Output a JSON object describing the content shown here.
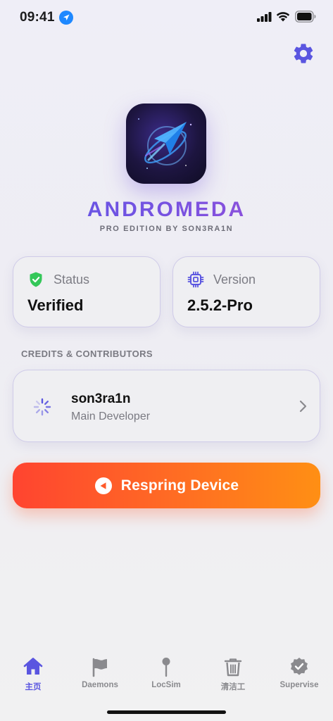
{
  "status_bar": {
    "time": "09:41",
    "icons": [
      "location-arrow-icon",
      "cellular-signal-icon",
      "wifi-icon",
      "battery-icon"
    ]
  },
  "header": {
    "settings_icon": "gear-icon",
    "app_icon": "comet-arrow-logo",
    "title": "ANDROMEDA",
    "subtitle": "PRO EDITION BY SON3RA1N"
  },
  "info_cards": {
    "status": {
      "icon": "shield-check-icon",
      "label": "Status",
      "value": "Verified"
    },
    "version": {
      "icon": "chip-icon",
      "label": "Version",
      "value": "2.5.2-Pro"
    }
  },
  "credits": {
    "header": "CREDITS & CONTRIBUTORS",
    "items": [
      {
        "icon": "spinner-icon",
        "name": "son3ra1n",
        "role": "Main Developer"
      }
    ]
  },
  "respring": {
    "icon": "play-reverse-icon",
    "label": "Respring Device"
  },
  "tab_bar": {
    "tabs": [
      {
        "icon": "house-icon",
        "label": "主页",
        "active": true
      },
      {
        "icon": "flag-icon",
        "label": "Daemons",
        "active": false
      },
      {
        "icon": "pin-icon",
        "label": "LocSim",
        "active": false
      },
      {
        "icon": "trash-icon",
        "label": "清洁工",
        "active": false
      },
      {
        "icon": "checkmark-seal-icon",
        "label": "Supervise",
        "active": false
      }
    ]
  },
  "colors": {
    "accent": "#5a55e0",
    "status_green": "#34c759",
    "respring_start": "#ff4430",
    "respring_end": "#ff8f14"
  }
}
